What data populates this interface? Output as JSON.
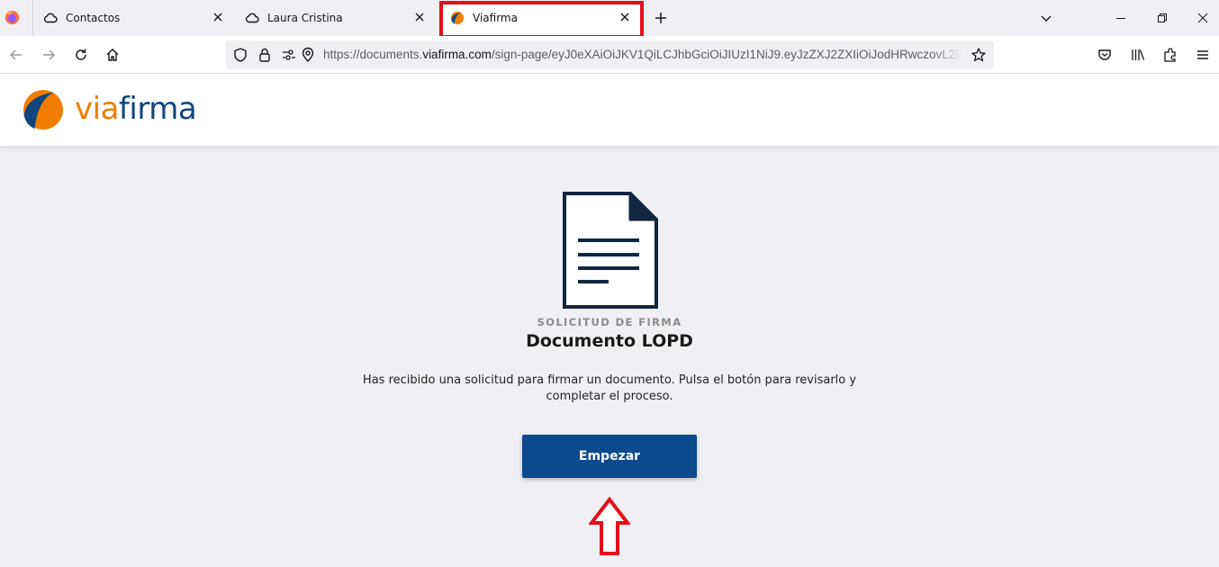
{
  "browser": {
    "tabs": [
      {
        "label": "Contactos",
        "icon": "cloud-icon",
        "active": false
      },
      {
        "label": "Laura Cristina",
        "icon": "cloud-icon",
        "active": false
      },
      {
        "label": "Viafirma",
        "icon": "viafirma-favicon-icon",
        "active": true
      }
    ],
    "url_prefix": "https://documents.",
    "url_domain": "viafirma.com",
    "url_path": "/sign-page/eyJ0eXAiOiJKV1QiLCJhbGciOiJIUzI1NiJ9.eyJzZXJ2ZXIiOiJodHRwczovL2Rv"
  },
  "site": {
    "brand_via": "via",
    "brand_firma": "firma"
  },
  "main": {
    "eyebrow": "SOLICITUD DE FIRMA",
    "title": "Documento LOPD",
    "description": "Has recibido una solicitud para firmar un documento. Pulsa el botón para revisarlo y completar el proceso.",
    "button_label": "Empezar"
  },
  "colors": {
    "brand_orange": "#f07d00",
    "brand_blue": "#10467e",
    "button_blue": "#0c4a8e",
    "annotation_red": "#e3101a"
  }
}
